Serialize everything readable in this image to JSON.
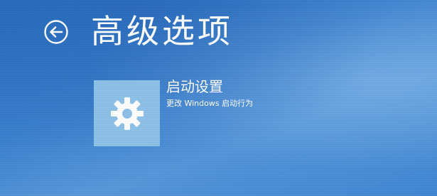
{
  "page": {
    "title": "高级选项",
    "back_icon": "back-arrow-icon"
  },
  "options": [
    {
      "title": "启动设置",
      "subtitle": "更改 Windows 启动行为",
      "icon": "gear-icon"
    }
  ],
  "colors": {
    "background": "#3a7ecb",
    "tile": "#8ec1e8",
    "text": "#ffffff"
  }
}
